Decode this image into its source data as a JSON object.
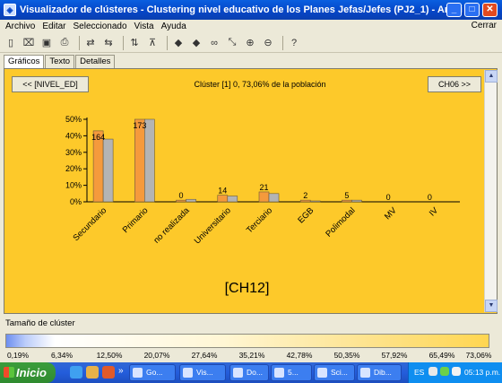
{
  "window": {
    "title": "Visualizador de clústeres - Clustering nivel educativo de los Planes Jefas/Jefes (PJ2_1) - Archivo local: general I...",
    "buttons": [
      "_",
      "□",
      "✕"
    ]
  },
  "menu": [
    "Archivo",
    "Editar",
    "Seleccionado",
    "Vista",
    "Ayuda"
  ],
  "menu_close": "Cerrar",
  "toolbar_icons": [
    "new-icon",
    "open-icon",
    "save-icon",
    "print-icon",
    "swap-icon",
    "swap-alt-icon",
    "sort-icon",
    "filter-icon",
    "arrow-left-icon",
    "arrow-right-icon",
    "find-icon",
    "zoom-fit-icon",
    "zoom-in-icon",
    "zoom-out-icon",
    "help-icon"
  ],
  "tabs": [
    "Gráficos",
    "Texto",
    "Detalles"
  ],
  "nav": {
    "prev": "<< [NIVEL_ED]",
    "next": "CH06 >>"
  },
  "cluster_info": "Clúster [1] 0, 73,06% de la población",
  "cluster_label": "[CH12]",
  "chart_data": {
    "type": "bar",
    "categories": [
      "Secundario",
      "Primario",
      "no realizada",
      "Universitario",
      "Terciario",
      "EGB",
      "Polimodal",
      "MV",
      "IV"
    ],
    "series": [
      {
        "values": [
          43,
          50,
          1,
          4,
          6,
          1,
          1,
          0,
          0
        ],
        "color": "#f59a3c"
      },
      {
        "values": [
          38,
          50,
          1.5,
          3.5,
          5,
          0.5,
          1,
          0,
          0
        ],
        "color": "#b4b4b4"
      }
    ],
    "data_labels": [
      "164",
      "173",
      "0",
      "14",
      "21",
      "2",
      "5",
      "0",
      "0"
    ],
    "ylim": [
      0,
      50
    ],
    "yticks": [
      "0%",
      "10%",
      "20%",
      "30%",
      "40%",
      "50%"
    ],
    "grid": false,
    "legend": "none"
  },
  "cluster_size": {
    "label": "Tamaño de clúster",
    "ticks": [
      "0,19%",
      "6,34%",
      "12,50%",
      "20,07%",
      "27,64%",
      "35,21%",
      "42,78%",
      "50,35%",
      "57,92%",
      "65,49%",
      "73,06%"
    ]
  },
  "taskbar": {
    "start": "Inicio",
    "chevron": "»",
    "tasks": [
      "Go...",
      "Vis...",
      "Do...",
      "5...",
      "Sci...",
      "Dib..."
    ],
    "lang": "ES",
    "time": "05:13 p.m."
  }
}
